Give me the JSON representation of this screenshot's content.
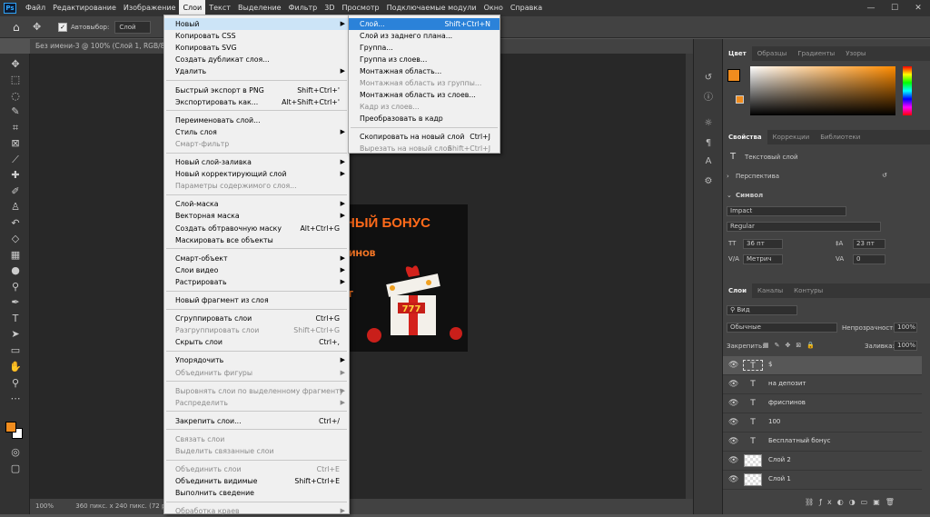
{
  "app": {
    "logo": "Ps"
  },
  "menubar": {
    "items": [
      "Файл",
      "Редактирование",
      "Изображение",
      "Слои",
      "Текст",
      "Выделение",
      "Фильтр",
      "3D",
      "Просмотр",
      "Подключаемые модули",
      "Окно",
      "Справка"
    ],
    "active": "Слои"
  },
  "window_controls": {
    "minimize": "—",
    "maximize": "☐",
    "close": "✕"
  },
  "options_bar": {
    "autoselect_label": "Автовыбор:",
    "autoselect_value": "Слой"
  },
  "document": {
    "tab_title": "Без имени-3 @ 100% (Слой 1, RGB/8#)",
    "zoom": "100%",
    "doc_info": "360 пикс. x 240 пикс. (72 ppi)"
  },
  "artwork": {
    "title": "НЫЙ БОНУС",
    "subtitle": "ИНОВ",
    "letter": "Т"
  },
  "layers_menu": {
    "items": [
      {
        "label": "Новый",
        "arrow": true,
        "highlight": true
      },
      {
        "label": "Копировать CSS"
      },
      {
        "label": "Копировать SVG"
      },
      {
        "label": "Создать дубликат слоя..."
      },
      {
        "label": "Удалить",
        "arrow": true
      },
      {
        "sep": true
      },
      {
        "label": "Быстрый экспорт в PNG",
        "shortcut": "Shift+Ctrl+'"
      },
      {
        "label": "Экспортировать как...",
        "shortcut": "Alt+Shift+Ctrl+'"
      },
      {
        "sep": true
      },
      {
        "label": "Переименовать слой..."
      },
      {
        "label": "Стиль слоя",
        "arrow": true
      },
      {
        "label": "Смарт-фильтр",
        "disabled": true
      },
      {
        "sep": true
      },
      {
        "label": "Новый слой-заливка",
        "arrow": true
      },
      {
        "label": "Новый корректирующий слой",
        "arrow": true
      },
      {
        "label": "Параметры содержимого слоя...",
        "disabled": true
      },
      {
        "sep": true
      },
      {
        "label": "Слой-маска",
        "arrow": true
      },
      {
        "label": "Векторная маска",
        "arrow": true
      },
      {
        "label": "Создать обтравочную маску",
        "shortcut": "Alt+Ctrl+G"
      },
      {
        "label": "Маскировать все объекты"
      },
      {
        "sep": true
      },
      {
        "label": "Смарт-объект",
        "arrow": true
      },
      {
        "label": "Слои видео",
        "arrow": true
      },
      {
        "label": "Растрировать",
        "arrow": true
      },
      {
        "sep": true
      },
      {
        "label": "Новый фрагмент из слоя"
      },
      {
        "sep": true
      },
      {
        "label": "Сгруппировать слои",
        "shortcut": "Ctrl+G"
      },
      {
        "label": "Разгруппировать слои",
        "shortcut": "Shift+Ctrl+G",
        "disabled": true
      },
      {
        "label": "Скрыть слои",
        "shortcut": "Ctrl+,"
      },
      {
        "sep": true
      },
      {
        "label": "Упорядочить",
        "arrow": true
      },
      {
        "label": "Объединить фигуры",
        "arrow": true,
        "disabled": true
      },
      {
        "sep": true
      },
      {
        "label": "Выровнять слои по выделенному фрагменту",
        "arrow": true,
        "disabled": true
      },
      {
        "label": "Распределить",
        "arrow": true,
        "disabled": true
      },
      {
        "sep": true
      },
      {
        "label": "Закрепить слои...",
        "shortcut": "Ctrl+/"
      },
      {
        "sep": true
      },
      {
        "label": "Связать слои",
        "disabled": true
      },
      {
        "label": "Выделить связанные слои",
        "disabled": true
      },
      {
        "sep": true
      },
      {
        "label": "Объединить слои",
        "shortcut": "Ctrl+E",
        "disabled": true
      },
      {
        "label": "Объединить видимые",
        "shortcut": "Shift+Ctrl+E"
      },
      {
        "label": "Выполнить сведение"
      },
      {
        "sep": true
      },
      {
        "label": "Обработка краев",
        "arrow": true,
        "disabled": true
      }
    ]
  },
  "new_submenu": {
    "items": [
      {
        "label": "Слой...",
        "shortcut": "Shift+Ctrl+N",
        "highlight": true
      },
      {
        "label": "Слой из заднего плана..."
      },
      {
        "label": "Группа..."
      },
      {
        "label": "Группа из слоев..."
      },
      {
        "label": "Монтажная область..."
      },
      {
        "label": "Монтажная область из группы...",
        "disabled": true
      },
      {
        "label": "Монтажная область из слоев..."
      },
      {
        "label": "Кадр из слоев...",
        "disabled": true
      },
      {
        "label": "Преобразовать в кадр"
      },
      {
        "sep": true
      },
      {
        "label": "Скопировать на новый слой",
        "shortcut": "Ctrl+J"
      },
      {
        "label": "Вырезать на новый слой",
        "shortcut": "Shift+Ctrl+J",
        "disabled": true
      }
    ]
  },
  "color_panel": {
    "tabs": [
      "Цвет",
      "Образцы",
      "Градиенты",
      "Узоры"
    ],
    "foreground": "#f08c1e",
    "background": "#ffffff"
  },
  "properties_panel": {
    "tabs": [
      "Свойства",
      "Коррекции",
      "Библиотеки"
    ],
    "layer_type": "Текстовый слой",
    "perspective_label": "Перспектива",
    "symbol_label": "Символ",
    "font": "Impact",
    "style": "Regular",
    "size": "36 пт",
    "leading": "23 пт",
    "kerning": "Метрич",
    "tracking": "0"
  },
  "layers_panel": {
    "tabs": [
      "Слои",
      "Каналы",
      "Контуры"
    ],
    "filter_label": "Вид",
    "blend_mode": "Обычные",
    "opacity_label": "Непрозрачность:",
    "opacity": "100%",
    "lock_label": "Закрепить:",
    "fill_label": "Заливка:",
    "fill": "100%",
    "layers": [
      {
        "name": "$",
        "type": "text",
        "selected": true
      },
      {
        "name": "на депозит",
        "type": "text"
      },
      {
        "name": "фриспинов",
        "type": "text"
      },
      {
        "name": "100",
        "type": "text"
      },
      {
        "name": "Бесплатный бонус",
        "type": "text"
      },
      {
        "name": "Слой 2",
        "type": "pixel"
      },
      {
        "name": "Слой 1",
        "type": "pixel"
      }
    ]
  }
}
